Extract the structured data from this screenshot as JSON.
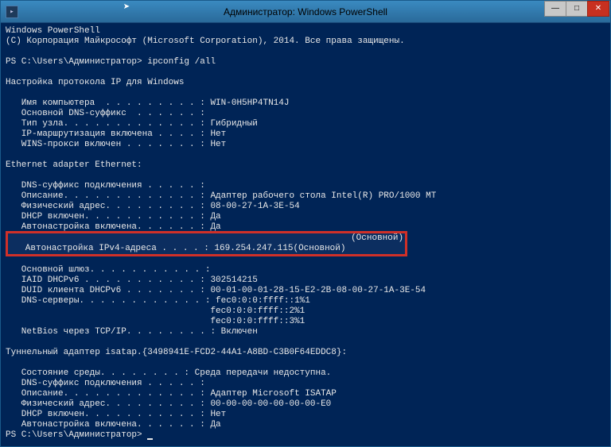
{
  "window": {
    "title": "Администратор: Windows PowerShell",
    "icon_glyph": "▸"
  },
  "terminal": {
    "header1": "Windows PowerShell",
    "header2": "(C) Корпорация Майкрософт (Microsoft Corporation), 2014. Все права защищены.",
    "prompt1": "PS C:\\Users\\Администратор> ipconfig /all",
    "cfg_title": "Настройка протокола IP для Windows",
    "host": {
      "name_label": "   Имя компьютера  . . . . . . . . . : ",
      "name_val": "WIN-0H5HP4TN14J",
      "dns_label": "   Основной DNS-суффикс  . . . . . . :",
      "type_label": "   Тип узла. . . . . . . . . . . . . : ",
      "type_val": "Гибридный",
      "iprout_label": "   IP-маршрутизация включена . . . . : ",
      "iprout_val": "Нет",
      "wins_label": "   WINS-прокси включен . . . . . . . : ",
      "wins_val": "Нет"
    },
    "eth_title": "Ethernet adapter Ethernet:",
    "eth": {
      "dnssfx_label": "   DNS-суффикс подключения . . . . . :",
      "desc_label": "   Описание. . . . . . . . . . . . . : ",
      "desc_val": "Адаптер рабочего стола Intel(R) PRO/1000 MT",
      "phys_label": "   Физический адрес. . . . . . . . . : ",
      "phys_val": "08-00-27-1A-3E-54",
      "dhcp_label": "   DHCP включен. . . . . . . . . . . : ",
      "dhcp_val": "Да",
      "auto_label": "   Автонастройка включена. . . . . . : ",
      "auto_val": "Да",
      "ipv6_tail": "(Основной)",
      "ipv4_label": "   Автонастройка IPv4-адреса . . . . : ",
      "ipv4_val": "169.254.247.115(Основной)",
      "gw_label": "   Основной шлюз. . . . . . . . . . . :",
      "iaid_label": "   IAID DHCPv6 . . . . . . . . . . . : ",
      "iaid_val": "302514215",
      "duid_label": "   DUID клиента DHCPv6 . . . . . . . : ",
      "duid_val": "00-01-00-01-28-15-E2-2B-08-00-27-1A-3E-54",
      "dns_label": "   DNS-серверы. . . . . . . . . . . . : ",
      "dns_val1": "fec0:0:0:ffff::1%1",
      "dns_val2": "                                       fec0:0:0:ffff::2%1",
      "dns_val3": "                                       fec0:0:0:ffff::3%1",
      "nb_label": "   NetBios через TCP/IP. . . . . . . . : ",
      "nb_val": "Включен"
    },
    "tun_title": "Туннельный адаптер isatap.{3498941E-FCD2-44A1-A8BD-C3B0F64EDDC8}:",
    "tun": {
      "state_label": "   Состояние среды. . . . . . . . : ",
      "state_val": "Среда передачи недоступна.",
      "dnssfx_label": "   DNS-суффикс подключения . . . . . :",
      "desc_label": "   Описание. . . . . . . . . . . . . : ",
      "desc_val": "Адаптер Microsoft ISATAP",
      "phys_label": "   Физический адрес. . . . . . . . . : ",
      "phys_val": "00-00-00-00-00-00-00-E0",
      "dhcp_label": "   DHCP включен. . . . . . . . . . . : ",
      "dhcp_val": "Нет",
      "auto_label": "   Автонастройка включена. . . . . . : ",
      "auto_val": "Да"
    },
    "prompt2": "PS C:\\Users\\Администратор> "
  }
}
